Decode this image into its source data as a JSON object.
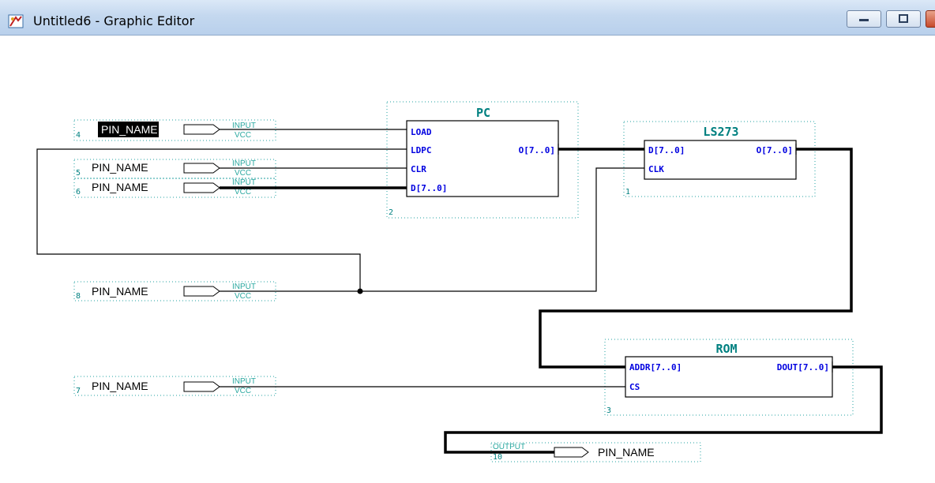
{
  "window": {
    "title": "Untitled6 - Graphic Editor",
    "icon": "graphic-editor-icon",
    "buttons": [
      "minimize-icon",
      "maximize-icon",
      "close-icon"
    ]
  },
  "components": {
    "pc": {
      "title": "PC",
      "number": "2",
      "ports_left": [
        "LOAD",
        "LDPC",
        "CLR",
        "D[7..0]"
      ],
      "ports_right": [
        "O[7..0]"
      ]
    },
    "ls273": {
      "title": "LS273",
      "number": "1",
      "ports_left": [
        "D[7..0]",
        "CLK"
      ],
      "ports_right": [
        "O[7..0]"
      ]
    },
    "rom": {
      "title": "ROM",
      "number": "3",
      "ports_left": [
        "ADDR[7..0]",
        "CS"
      ],
      "ports_right": [
        "DOUT[7..0]"
      ]
    }
  },
  "inputs": [
    {
      "name": "PIN_NAME",
      "number": "4",
      "type": "INPUT",
      "sub": "VCC",
      "selected": true
    },
    {
      "name": "PIN_NAME",
      "number": "5",
      "type": "INPUT",
      "sub": "VCC",
      "selected": false
    },
    {
      "name": "PIN_NAME",
      "number": "6",
      "type": "INPUT",
      "sub": "VCC",
      "selected": false
    },
    {
      "name": "PIN_NAME",
      "number": "8",
      "type": "INPUT",
      "sub": "VCC",
      "selected": false
    },
    {
      "name": "PIN_NAME",
      "number": "7",
      "type": "INPUT",
      "sub": "VCC",
      "selected": false
    }
  ],
  "output": {
    "name": "PIN_NAME",
    "number": "10",
    "type": "OUTPUT"
  },
  "colors": {
    "port_text": "#0000e0",
    "title_text": "#008080",
    "dotted": "#20a0a0",
    "wire": "#000000"
  }
}
